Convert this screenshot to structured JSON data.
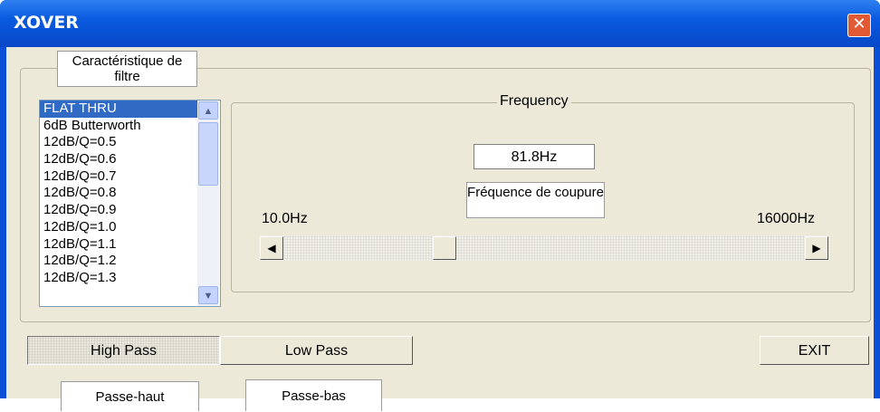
{
  "window": {
    "title": "XOVER",
    "close_glyph": "✕",
    "titlebar_color": "#0a5ae0",
    "close_color": "#e25a35"
  },
  "filter_list": {
    "items": [
      "FLAT THRU",
      "6dB Butterworth",
      "12dB/Q=0.5",
      "12dB/Q=0.6",
      "12dB/Q=0.7",
      "12dB/Q=0.8",
      "12dB/Q=0.9",
      "12dB/Q=1.0",
      "12dB/Q=1.1",
      "12dB/Q=1.2",
      "12dB/Q=1.3"
    ],
    "selected": "FLAT THRU",
    "scroll_up_icon": "chevron-up-icon",
    "scroll_down_icon": "chevron-down-icon",
    "selection_color": "#316ac5"
  },
  "frequency": {
    "group_label": "Frequency",
    "value": "81.8Hz",
    "min_label": "10.0Hz",
    "max_label": "16000Hz",
    "slider_position": 0.3,
    "left_arrow": "◀",
    "right_arrow": "▶"
  },
  "buttons": {
    "high_pass": "High Pass",
    "low_pass": "Low Pass",
    "exit": "EXIT",
    "active": "High Pass"
  },
  "callouts": {
    "filter_characteristic": "Caractéristique de filtre",
    "cutoff_frequency": "Fréquence de coupure",
    "high_pass": "Passe-haut",
    "low_pass": "Passe-bas"
  }
}
